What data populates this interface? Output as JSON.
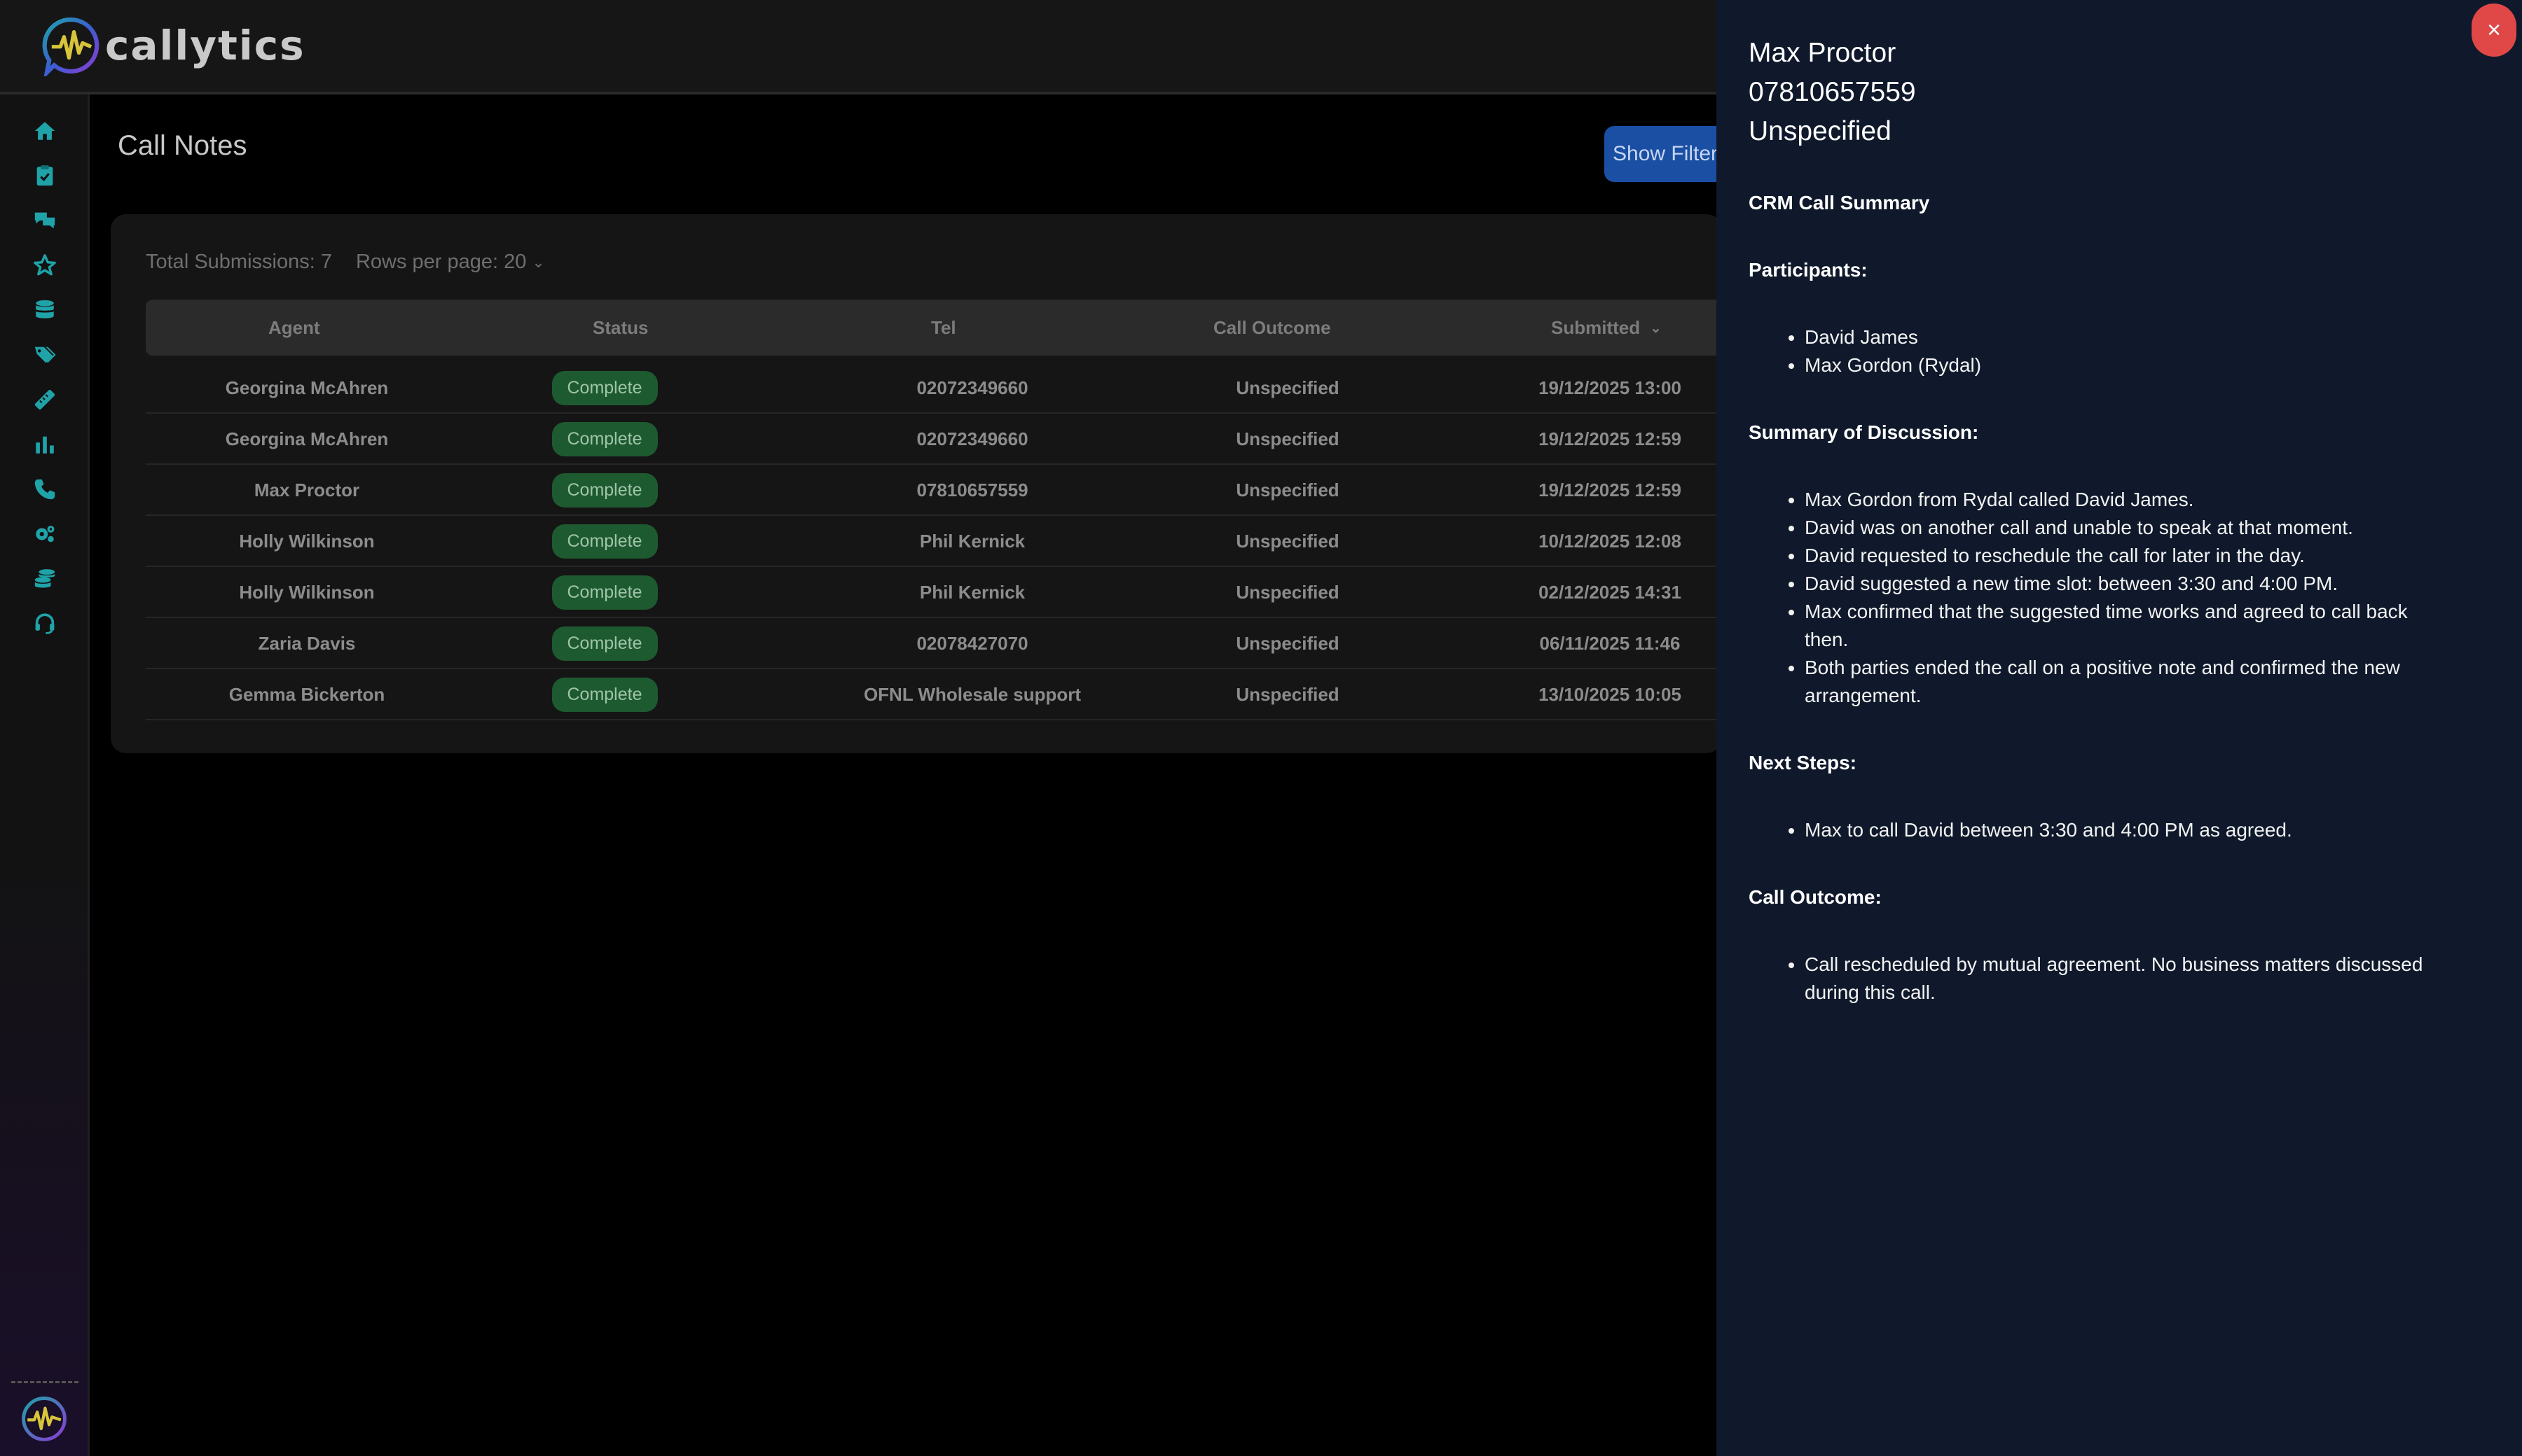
{
  "app": {
    "brand": "callytics"
  },
  "colors": {
    "accent_teal": "#1fa3a8",
    "badge_green": "#1e5a30",
    "primary_blue": "#1a4fa3",
    "close_red": "#e04848",
    "drawer_bg": "#0f192b"
  },
  "sidebar": {
    "items": [
      {
        "icon": "home-icon"
      },
      {
        "icon": "clipboard-check-icon"
      },
      {
        "icon": "chat-bubbles-icon"
      },
      {
        "icon": "star-icon"
      },
      {
        "icon": "database-icon"
      },
      {
        "icon": "tag-icon"
      },
      {
        "icon": "ruler-icon"
      },
      {
        "icon": "bar-chart-icon"
      },
      {
        "icon": "phone-icon"
      },
      {
        "icon": "gears-icon"
      },
      {
        "icon": "coins-icon"
      },
      {
        "icon": "headset-icon"
      }
    ]
  },
  "page": {
    "title": "Call Notes",
    "show_filters_label": "Show Filters",
    "total_submissions": "Total Submissions: 7",
    "rows_per_page": "Rows per page: 20"
  },
  "table": {
    "headers": {
      "agent": "Agent",
      "status": "Status",
      "tel": "Tel",
      "call_outcome": "Call Outcome",
      "submitted": "Submitted"
    },
    "rows": [
      {
        "agent": "Georgina McAhren",
        "status": "Complete",
        "tel": "02072349660",
        "outcome": "Unspecified",
        "submitted": "19/12/2025 13:00"
      },
      {
        "agent": "Georgina McAhren",
        "status": "Complete",
        "tel": "02072349660",
        "outcome": "Unspecified",
        "submitted": "19/12/2025 12:59"
      },
      {
        "agent": "Max Proctor",
        "status": "Complete",
        "tel": "07810657559",
        "outcome": "Unspecified",
        "submitted": "19/12/2025 12:59"
      },
      {
        "agent": "Holly Wilkinson",
        "status": "Complete",
        "tel": "Phil Kernick",
        "outcome": "Unspecified",
        "submitted": "10/12/2025 12:08"
      },
      {
        "agent": "Holly Wilkinson",
        "status": "Complete",
        "tel": "Phil Kernick",
        "outcome": "Unspecified",
        "submitted": "02/12/2025 14:31"
      },
      {
        "agent": "Zaria Davis",
        "status": "Complete",
        "tel": "02078427070",
        "outcome": "Unspecified",
        "submitted": "06/11/2025 11:46"
      },
      {
        "agent": "Gemma Bickerton",
        "status": "Complete",
        "tel": "OFNL Wholesale support",
        "outcome": "Unspecified",
        "submitted": "13/10/2025 10:05"
      }
    ]
  },
  "drawer": {
    "close_label": "×",
    "name": "Max Proctor",
    "phone": "07810657559",
    "outcome": "Unspecified",
    "summary_title": "CRM Call Summary",
    "participants_heading": "Participants:",
    "participants": [
      "David James",
      "Max Gordon (Rydal)"
    ],
    "discussion_heading": "Summary of Discussion:",
    "discussion": [
      "Max Gordon from Rydal called David James.",
      "David was on another call and unable to speak at that moment.",
      "David requested to reschedule the call for later in the day.",
      "David suggested a new time slot: between 3:30 and 4:00 PM.",
      "Max confirmed that the suggested time works and agreed to call back then.",
      "Both parties ended the call on a positive note and confirmed the new arrangement."
    ],
    "next_steps_heading": "Next Steps:",
    "next_steps": [
      "Max to call David between 3:30 and 4:00 PM as agreed."
    ],
    "call_outcome_heading": "Call Outcome:",
    "call_outcome": [
      "Call rescheduled by mutual agreement. No business matters discussed during this call."
    ]
  }
}
